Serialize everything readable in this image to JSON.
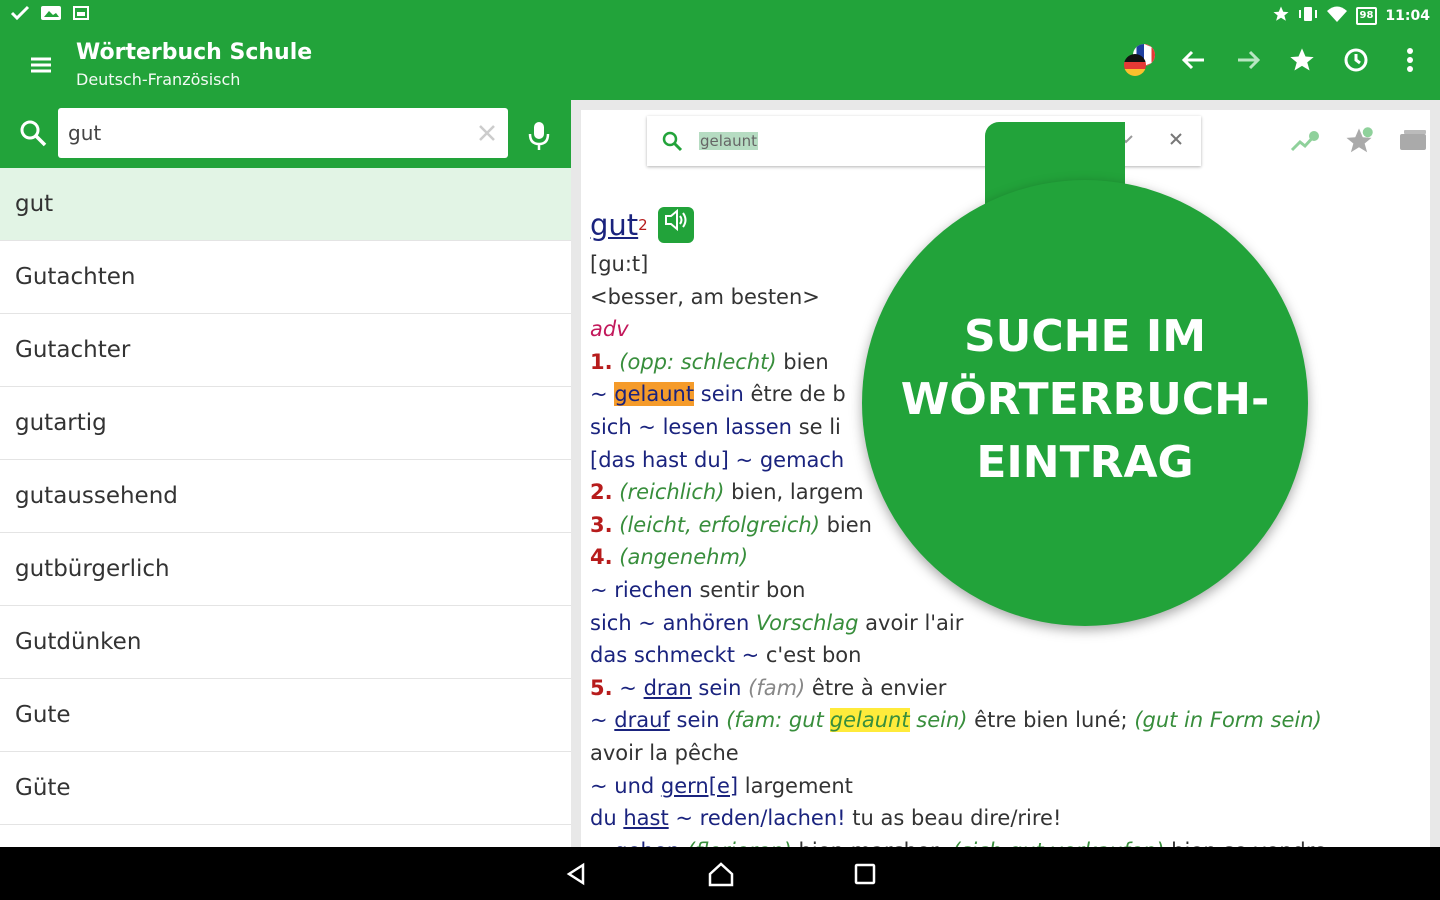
{
  "status_bar": {
    "time": "11:04",
    "battery": "98"
  },
  "app_bar": {
    "title": "Wörterbuch Schule",
    "subtitle": "Deutsch-Französisch"
  },
  "search": {
    "query": "gut"
  },
  "word_list": [
    "gut",
    "Gutachten",
    "Gutachter",
    "gutartig",
    "gutaussehend",
    "gutbürgerlich",
    "Gutdünken",
    "Gute",
    "Güte"
  ],
  "entry_search": {
    "query": "gelaunt"
  },
  "entry": {
    "headword": "gut",
    "superscript": "2",
    "pronunciation": "[gu:t]",
    "forms": "<besser, am besten>",
    "pos": "adv",
    "s1_num": "1.",
    "s1_label": "(opp: schlecht)",
    "s1_trans": "bien",
    "e1_tilde": "~",
    "e1_word": "gelaunt",
    "e1_rest": "sein",
    "e1_trans": "être de b",
    "e2_de": "sich ~ lesen lassen",
    "e2_fr": "se li",
    "e3_de": "[das hast du] ~ gemach",
    "s2_num": "2.",
    "s2_label": "(reichlich)",
    "s2_trans": "bien, largem",
    "s3_num": "3.",
    "s3_label": "(leicht, erfolgreich)",
    "s3_trans": "bien",
    "s4_num": "4.",
    "s4_label": "(angenehm)",
    "e4_de": "~ riechen",
    "e4_fr": "sentir bon",
    "e5_de1": "sich ~ anhören",
    "e5_tag": "Vorschlag",
    "e5_fr": "avoir l'air",
    "e6_de": "das schmeckt ~",
    "e6_fr": "c'est bon",
    "s5_num": "5.",
    "e7_tilde": "~",
    "e7_word": "dran",
    "e7_rest": "sein",
    "e7_label": "(fam)",
    "e7_fr": "être à envier",
    "e8_tilde": "~",
    "e8_word": "drauf",
    "e8_rest": "sein",
    "e8_label_a": "(fam: gut",
    "e8_label_hl": "gelaunt",
    "e8_label_b": "sein)",
    "e8_fr": "être bien luné;",
    "e8_label2": "(gut in Form sein)",
    "e8_fr2": "avoir la pêche",
    "e9_a": "~ und",
    "e9_word": "gern[e]",
    "e9_fr": "largement",
    "e10_a": "du",
    "e10_word": "hast",
    "e10_b": "~ reden/lachen!",
    "e10_fr": "tu as beau dire/rire!",
    "e11_de": "~ gehen",
    "e11_label": "(florieren)",
    "e11_fr": "bien marcher;",
    "e11_label2": "(sich gut verkaufen)",
    "e11_fr2": "bien se vendre"
  },
  "promo": {
    "line1": "SUCHE IM",
    "line2": "WÖRTERBUCH-",
    "line3": "EINTRAG"
  },
  "colors": {
    "primary": "#22a33a",
    "selected_row": "#e2f4e5",
    "headword": "#1a237e",
    "label": "#388e3c",
    "sense_number": "#b71c1c"
  }
}
